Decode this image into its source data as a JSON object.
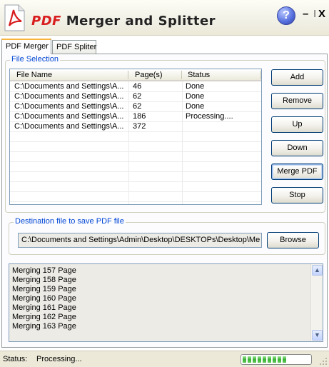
{
  "window": {
    "title_pdf": "PDF",
    "title_rest": "Merger and Splitter",
    "help_label": "?",
    "minimize_label": "–",
    "separator_label": "I",
    "close_label": "X"
  },
  "tabs": [
    {
      "label": "PDF Merger",
      "active": true
    },
    {
      "label": "PDF Spliter",
      "active": false
    }
  ],
  "file_selection": {
    "legend": "File Selection",
    "columns": [
      "File Name",
      "Page(s)",
      "Status"
    ],
    "rows": [
      {
        "file": "C:\\Documents and Settings\\A...",
        "pages": "46",
        "status": "Done"
      },
      {
        "file": "C:\\Documents and Settings\\A...",
        "pages": "62",
        "status": "Done"
      },
      {
        "file": "C:\\Documents and Settings\\A...",
        "pages": "62",
        "status": "Done"
      },
      {
        "file": "C:\\Documents and Settings\\A...",
        "pages": "186",
        "status": "Processing...."
      },
      {
        "file": "C:\\Documents and Settings\\A...",
        "pages": "372",
        "status": ""
      }
    ]
  },
  "buttons": {
    "add": "Add",
    "remove": "Remove",
    "up": "Up",
    "down": "Down",
    "merge": "Merge PDF",
    "stop": "Stop",
    "browse": "Browse"
  },
  "destination": {
    "legend": "Destination file to save PDF file",
    "path": "C:\\Documents and Settings\\Admin\\Desktop\\DESKTOPs\\Desktop\\Me"
  },
  "log": [
    "Merging 157 Page",
    "Merging 158 Page",
    "Merging 159 Page",
    "Merging 160 Page",
    "Merging 161 Page",
    "Merging 162 Page",
    "Merging 163 Page"
  ],
  "status_bar": {
    "label": "Status:",
    "value": "Processing...",
    "progress_fraction": 0.7
  },
  "colors": {
    "accent": "#0046d5",
    "title_pdf": "#d81e1e",
    "progress": "#3bb236"
  },
  "icons": {
    "logo": "pdf-document-icon",
    "help": "help-icon",
    "scroll_up": "scroll-up-arrow-icon",
    "scroll_down": "scroll-down-arrow-icon"
  }
}
